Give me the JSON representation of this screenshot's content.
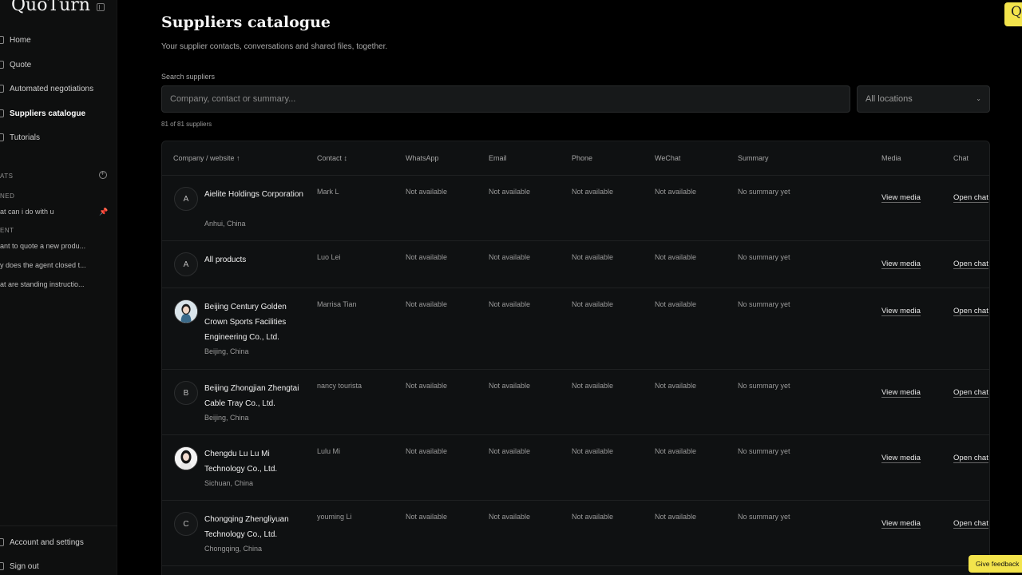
{
  "app": {
    "logo": "QuoTurn"
  },
  "sidebar": {
    "nav": [
      {
        "label": "Home"
      },
      {
        "label": "Quote"
      },
      {
        "label": "Automated negotiations"
      },
      {
        "label": "Suppliers catalogue"
      },
      {
        "label": "Tutorials"
      }
    ],
    "chats_label": "ATS",
    "pinned_label": "NED",
    "pinned": [
      {
        "label": "at can i do with u"
      }
    ],
    "recent_label": "ENT",
    "recent": [
      {
        "label": "ant to quote a new produ..."
      },
      {
        "label": "y does the agent closed t..."
      },
      {
        "label": "at are standing instructio..."
      }
    ],
    "account": "Account and settings",
    "signout": "Sign out"
  },
  "main": {
    "title": "Suppliers catalogue",
    "subtitle": "Your supplier contacts, conversations and shared files, together.",
    "search_label": "Search suppliers",
    "search_placeholder": "Company, contact or summary...",
    "location_filter": "All locations",
    "count": "81 of 81 suppliers"
  },
  "table": {
    "headers": {
      "company": "Company / website ↑",
      "contact": "Contact ↕",
      "whatsapp": "WhatsApp",
      "email": "Email",
      "phone": "Phone",
      "wechat": "WeChat",
      "summary": "Summary",
      "media": "Media",
      "chat": "Chat"
    },
    "rows": [
      {
        "initial": "A",
        "company": "Aielite Holdings Corporation",
        "location": "Anhui, China",
        "contact": "Mark L",
        "whatsapp": "Not available",
        "email": "Not available",
        "phone": "Not available",
        "wechat": "Not available",
        "summary": "No summary yet",
        "media": "View media",
        "chat": "Open chat"
      },
      {
        "initial": "A",
        "company": "All products",
        "location": "",
        "contact": "Luo Lei",
        "whatsapp": "Not available",
        "email": "Not available",
        "phone": "Not available",
        "wechat": "Not available",
        "summary": "No summary yet",
        "media": "View media",
        "chat": "Open chat"
      },
      {
        "initial": "",
        "company": "Beijing Century Golden Crown Sports Facilities Engineering Co., Ltd.",
        "location": "Beijing, China",
        "contact": "Marrisa Tian",
        "whatsapp": "Not available",
        "email": "Not available",
        "phone": "Not available",
        "wechat": "Not available",
        "summary": "No summary yet",
        "media": "View media",
        "chat": "Open chat"
      },
      {
        "initial": "B",
        "company": "Beijing Zhongjian Zhengtai Cable Tray Co., Ltd.",
        "location": "Beijing, China",
        "contact": "nancy tourista",
        "whatsapp": "Not available",
        "email": "Not available",
        "phone": "Not available",
        "wechat": "Not available",
        "summary": "No summary yet",
        "media": "View media",
        "chat": "Open chat"
      },
      {
        "initial": "",
        "company": "Chengdu Lu Lu Mi Technology Co., Ltd.",
        "location": "Sichuan, China",
        "contact": "Lulu Mi",
        "whatsapp": "Not available",
        "email": "Not available",
        "phone": "Not available",
        "wechat": "Not available",
        "summary": "No summary yet",
        "media": "View media",
        "chat": "Open chat"
      },
      {
        "initial": "C",
        "company": "Chongqing Zhengliyuan Technology Co., Ltd.",
        "location": "Chongqing, China",
        "contact": "youming Li",
        "whatsapp": "Not available",
        "email": "Not available",
        "phone": "Not available",
        "wechat": "Not available",
        "summary": "No summary yet",
        "media": "View media",
        "chat": "Open chat"
      }
    ]
  },
  "feedback": "Give feedback",
  "corner_badge": "Q",
  "colors": {
    "accent": "#f3e44c",
    "background": "#000000",
    "sidebar": "#0e0f0f"
  }
}
